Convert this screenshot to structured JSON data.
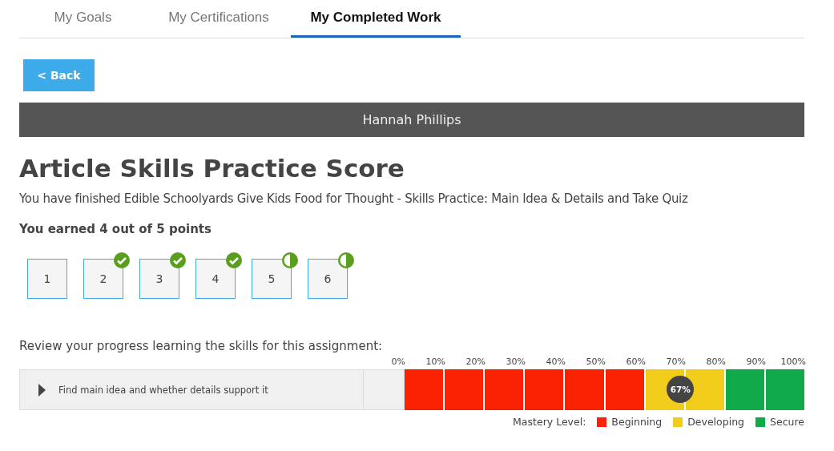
{
  "tabs": [
    {
      "label": "My Goals",
      "selected": false
    },
    {
      "label": "My Certifications",
      "selected": false
    },
    {
      "label": "My Completed Work",
      "selected": true
    }
  ],
  "back_button": "< Back",
  "student_name": "Hannah Phillips",
  "title": "Article Skills Practice Score",
  "subtitle": "You have finished Edible Schoolyards Give Kids Food for Thought - Skills Practice: Main Idea & Details and Take Quiz",
  "score": "You earned 4 out of 5 points",
  "questions": [
    {
      "label": "1",
      "kind": "unscored"
    },
    {
      "label": "2",
      "kind": "correct"
    },
    {
      "label": "3",
      "kind": "correct"
    },
    {
      "label": "4",
      "kind": "correct"
    },
    {
      "label": "5",
      "kind": "partial"
    },
    {
      "label": "6",
      "kind": "partial"
    }
  ],
  "progress_prompt": "Review your progress learning the skills for this assignment:",
  "scale_ticks": [
    "0%",
    "10%",
    "20%",
    "30%",
    "40%",
    "50%",
    "60%",
    "70%",
    "80%",
    "90%",
    "100%"
  ],
  "skills": [
    {
      "name": "Find main idea and whether details support it",
      "expanded": false,
      "reading": "67%",
      "segments": [
        {
          "color": "#fa2200"
        },
        {
          "color": "#fa2200"
        },
        {
          "color": "#fa2200"
        },
        {
          "color": "#fa2200"
        },
        {
          "color": "#fa2200"
        },
        {
          "color": "#fa2200"
        },
        {
          "color": "#f2cc1a"
        },
        {
          "color": "#f2cc1a"
        },
        {
          "color": "#10aa4a"
        },
        {
          "color": "#10aa4a"
        }
      ]
    }
  ],
  "legend": {
    "label": "Mastery Level:",
    "items": [
      {
        "label": "Beginning",
        "color": "#fa2200"
      },
      {
        "label": "Developing",
        "color": "#f2cc1a"
      },
      {
        "label": "Secure",
        "color": "#10aa4a"
      }
    ]
  }
}
